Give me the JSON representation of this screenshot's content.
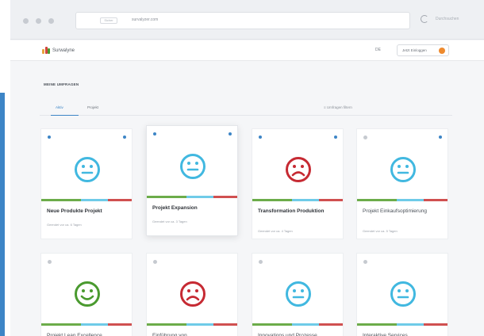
{
  "browser": {
    "dots": 3,
    "address_url": "survalyzer.com",
    "address_badge": "Sicher",
    "search_placeholder": "Durchsuchen"
  },
  "app": {
    "logo_text": "Surwalyne",
    "language": "DE",
    "login_label": "Jetzt Einloggen",
    "section_title": "MEINE UMFRAGEN",
    "tabs": [
      {
        "label": "Aktiv",
        "active": true
      },
      {
        "label": "Projekt",
        "active": false
      }
    ],
    "filter_label": "Umfragen filtern"
  },
  "colors": {
    "accent": "#3d85c6",
    "happy": "#4a9a2f",
    "neutral": "#41b8e0",
    "sad": "#c62a33",
    "bar_green": "#6cac4a",
    "bar_blue": "#6fcbe8",
    "bar_red": "#d05050"
  },
  "cards": [
    {
      "title": "Neue Produkte Projekt",
      "subtitle": "Geendet vor ca. 6 Tagen",
      "mood": "neutral",
      "pin": "blue",
      "bold": true,
      "raised": false
    },
    {
      "title": "Projekt Expansion",
      "subtitle": "Geendet vor ca. 3 Tagen",
      "mood": "neutral",
      "pin": "blue",
      "bold": true,
      "raised": true
    },
    {
      "title": "Transformation Produktion",
      "subtitle": "Geendet vor ca. 4 Tagen",
      "mood": "sad",
      "pin": "blue",
      "bold": true,
      "raised": false
    },
    {
      "title": "Projekt Einkaufsoptimierung",
      "subtitle": "Geendet vor ca. 5 Tagen",
      "mood": "neutral",
      "pin": "muted",
      "bold": false,
      "raised": false
    },
    {
      "title": "Projekt Lean Excellence",
      "subtitle": "",
      "mood": "happy",
      "pin": "muted",
      "bold": false,
      "raised": false
    },
    {
      "title": "Einführung von",
      "subtitle": "",
      "mood": "sad",
      "pin": "muted",
      "bold": false,
      "raised": false
    },
    {
      "title": "Innovations und Prozesse",
      "subtitle": "",
      "mood": "neutral",
      "pin": "muted",
      "bold": false,
      "raised": false
    },
    {
      "title": "Interaktive Services",
      "subtitle": "",
      "mood": "neutral",
      "pin": "muted",
      "bold": false,
      "raised": false
    }
  ]
}
